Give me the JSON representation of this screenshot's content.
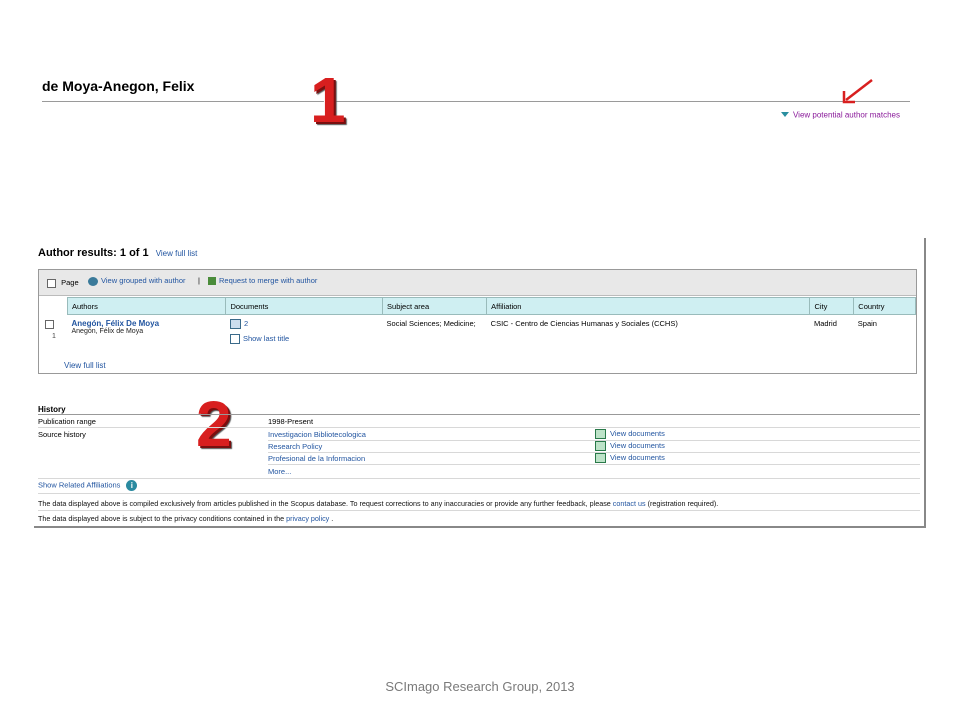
{
  "header": {
    "author_name": "de Moya-Anegon, Felix",
    "potential_matches_link": "View potential author matches",
    "callout_1": "1"
  },
  "results": {
    "title": "Author results: 1 of 1",
    "view_full_list_top": "View full list",
    "toolbar": {
      "page_label": "Page",
      "grouped_link": "View grouped with author",
      "separator": "|",
      "merge_link": "Request to merge with author"
    },
    "columns": [
      "Authors",
      "Documents",
      "Subject area",
      "Affiliation",
      "City",
      "Country"
    ],
    "rows": [
      {
        "index": "1",
        "author": "Anegón, Félix De Moya",
        "author_variant": "Anegón, Félix de Moya",
        "documents": "2",
        "show_last_title": "Show last title",
        "subject_area": "Social Sciences; Medicine;",
        "affiliation": "CSIC - Centro de Ciencias Humanas y Sociales (CCHS)",
        "city": "Madrid",
        "country": "Spain"
      }
    ],
    "view_full_list_bottom": "View full list"
  },
  "history": {
    "callout_2": "2",
    "title": "History",
    "publication_range_label": "Publication range",
    "publication_range_value": "1998-Present",
    "source_history_label": "Source history",
    "sources": [
      {
        "name": "Investigacion Bibliotecologica",
        "action": "View documents"
      },
      {
        "name": "Research Policy",
        "action": "View documents"
      },
      {
        "name": "Profesional de la Informacion",
        "action": "View documents"
      }
    ],
    "more": "More...",
    "related_affiliations": "Show Related Affiliations",
    "info_icon_glyph": "i"
  },
  "notes": {
    "corrections_before": "The data displayed above is compiled exclusively from articles published in the Scopus database. To request corrections to any inaccuracies or provide any further feedback, please",
    "contact_link": "contact us",
    "corrections_after": "(registration required).",
    "privacy_before": "The data displayed above is subject to the privacy conditions contained in the",
    "privacy_link": "privacy policy",
    "privacy_after": "."
  },
  "footer": {
    "text": "SCImago Research Group, 2013"
  },
  "colors": {
    "link": "#2255a0",
    "header_cell": "#cfeff2",
    "callout": "#d81f1f",
    "potential_link": "#8a1a9a"
  }
}
